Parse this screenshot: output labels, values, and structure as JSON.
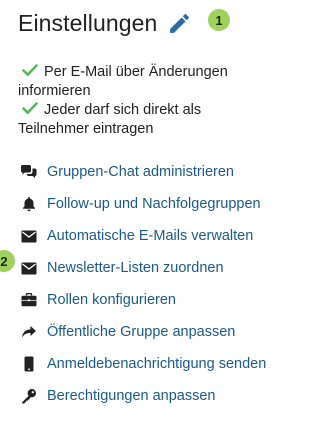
{
  "header": {
    "title": "Einstellungen",
    "edit_icon": "pencil-icon"
  },
  "badges": {
    "first": "1",
    "second": "2"
  },
  "checks": [
    {
      "icon": "checkmark-icon",
      "text_line1": "Per E-Mail über Änderungen",
      "text_line2": "informieren"
    },
    {
      "icon": "checkmark-icon",
      "text_line1": "Jeder darf sich direkt als",
      "text_line2": "Teilnehmer eintragen"
    }
  ],
  "links": [
    {
      "icon": "chat-icon",
      "label": "Gruppen-Chat administrieren"
    },
    {
      "icon": "bell-icon",
      "label": "Follow-up und Nachfolgegruppen"
    },
    {
      "icon": "envelope-icon",
      "label": "Automatische E-Mails verwalten"
    },
    {
      "icon": "envelope-icon",
      "label": "Newsletter-Listen zuordnen"
    },
    {
      "icon": "briefcase-icon",
      "label": "Rollen konfigurieren"
    },
    {
      "icon": "share-arrow-icon",
      "label": "Öffentliche Gruppe anpassen"
    },
    {
      "icon": "mobile-phone-icon",
      "label": "Anmeldebenachrichtigung senden"
    },
    {
      "icon": "key-icon",
      "label": "Berechtigungen anpassen"
    }
  ],
  "colors": {
    "link": "#1a5b8a",
    "check": "#5cb85c",
    "badge": "#9fd25d",
    "pencil": "#2a6aa8",
    "icon": "#222222"
  }
}
